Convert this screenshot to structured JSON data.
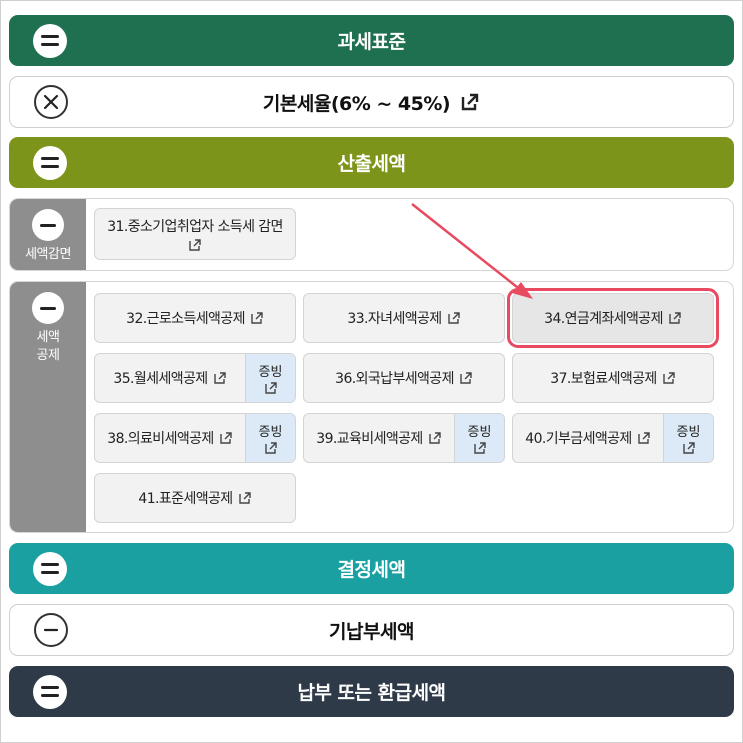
{
  "colors": {
    "bar1": "#1e7050",
    "bar2": "#7c9419",
    "bar3": "#1aa0a0",
    "bar4": "#2f3a48",
    "highlight": "#e84a5f"
  },
  "bars": {
    "b1": {
      "title": "과세표준",
      "icon": "collapse-icon"
    },
    "b2": {
      "title": "기본세율(6% ~ 45%)",
      "icon": "close-icon",
      "link_icon": "external-link-icon"
    },
    "b3": {
      "title": "산출세액",
      "icon": "collapse-icon"
    },
    "b4": {
      "title": "결정세액",
      "icon": "collapse-icon"
    },
    "b5": {
      "title": "기납부세액",
      "icon": "minus-circle-icon"
    },
    "b6": {
      "title": "납부 또는 환급세액",
      "icon": "collapse-icon"
    }
  },
  "reduction": {
    "label": "세액감면",
    "items": [
      {
        "label": "31.중소기업취업자 소득세 감면"
      }
    ]
  },
  "credit": {
    "label_line1": "세액",
    "label_line2": "공제",
    "evidence_label": "증빙",
    "items": [
      {
        "label": "32.근로소득세액공제"
      },
      {
        "label": "33.자녀세액공제"
      },
      {
        "label": "34.연금계좌세액공제"
      },
      {
        "label": "35.월세세액공제"
      },
      {
        "label": "36.외국납부세액공제"
      },
      {
        "label": "37.보험료세액공제"
      },
      {
        "label": "38.의료비세액공제"
      },
      {
        "label": "39.교육비세액공제"
      },
      {
        "label": "40.기부금세액공제"
      },
      {
        "label": "41.표준세액공제"
      }
    ]
  }
}
